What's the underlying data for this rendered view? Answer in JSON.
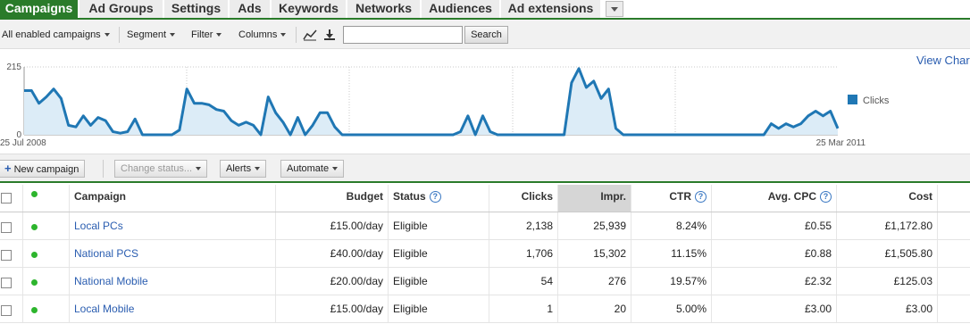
{
  "tabs": [
    {
      "label": "Campaigns",
      "active": true
    },
    {
      "label": "Ad Groups"
    },
    {
      "label": "Settings"
    },
    {
      "label": "Ads"
    },
    {
      "label": "Keywords"
    },
    {
      "label": "Networks"
    },
    {
      "label": "Audiences"
    },
    {
      "label": "Ad extensions"
    }
  ],
  "toolbar": {
    "filter_select": "All enabled campaigns",
    "segment": "Segment",
    "filter": "Filter",
    "columns": "Columns",
    "search_value": "",
    "search_button": "Search"
  },
  "chart_header": {
    "view_chart": "View Char"
  },
  "chart_data": {
    "type": "area",
    "series": [
      {
        "name": "Clicks",
        "color": "#1f77b4"
      }
    ],
    "values": [
      140,
      140,
      100,
      120,
      145,
      115,
      30,
      25,
      60,
      30,
      55,
      45,
      10,
      5,
      10,
      50,
      0,
      0,
      0,
      0,
      0,
      15,
      145,
      100,
      100,
      95,
      80,
      75,
      45,
      30,
      40,
      30,
      0,
      120,
      70,
      40,
      0,
      55,
      0,
      30,
      70,
      70,
      25,
      0,
      0,
      0,
      0,
      0,
      0,
      0,
      0,
      0,
      0,
      0,
      0,
      0,
      0,
      0,
      0,
      10,
      60,
      0,
      60,
      10,
      0,
      0,
      0,
      0,
      0,
      0,
      0,
      0,
      0,
      0,
      165,
      210,
      150,
      170,
      115,
      145,
      20,
      0,
      0,
      0,
      0,
      0,
      0,
      0,
      0,
      0,
      0,
      0,
      0,
      0,
      0,
      0,
      0,
      0,
      0,
      0,
      0,
      35,
      20,
      35,
      25,
      35,
      60,
      75,
      60,
      75,
      20
    ],
    "y_tick_labels": [
      "215",
      "0"
    ],
    "ylim": [
      0,
      215
    ],
    "x_start_label": "25 Jul 2008",
    "x_end_label": "25 Mar 2011",
    "grid": true,
    "legend_position": "right"
  },
  "actions": {
    "new_campaign": "New campaign",
    "change_status": "Change status...",
    "alerts": "Alerts",
    "automate": "Automate"
  },
  "table": {
    "headers": {
      "campaign": "Campaign",
      "budget": "Budget",
      "status": "Status",
      "clicks": "Clicks",
      "impr": "Impr.",
      "ctr": "CTR",
      "avg_cpc": "Avg. CPC",
      "cost": "Cost"
    },
    "rows": [
      {
        "campaign": "Local PCs",
        "budget": "£15.00/day",
        "status": "Eligible",
        "clicks": "2,138",
        "impr": "25,939",
        "ctr": "8.24%",
        "avg_cpc": "£0.55",
        "cost": "£1,172.80"
      },
      {
        "campaign": "National PCS",
        "budget": "£40.00/day",
        "status": "Eligible",
        "clicks": "1,706",
        "impr": "15,302",
        "ctr": "11.15%",
        "avg_cpc": "£0.88",
        "cost": "£1,505.80"
      },
      {
        "campaign": "National Mobile",
        "budget": "£20.00/day",
        "status": "Eligible",
        "clicks": "54",
        "impr": "276",
        "ctr": "19.57%",
        "avg_cpc": "£2.32",
        "cost": "£125.03"
      },
      {
        "campaign": "Local Mobile",
        "budget": "£15.00/day",
        "status": "Eligible",
        "clicks": "1",
        "impr": "20",
        "ctr": "5.00%",
        "avg_cpc": "£3.00",
        "cost": "£3.00"
      }
    ]
  }
}
